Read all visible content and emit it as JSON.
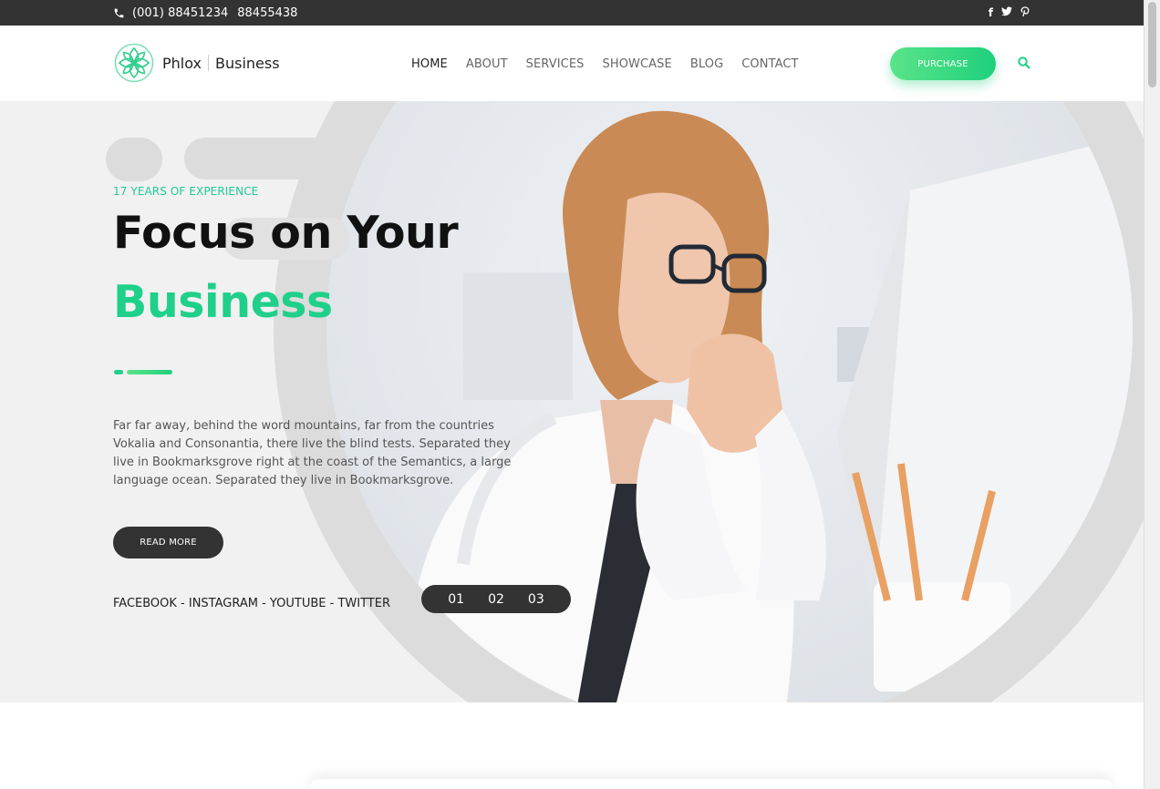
{
  "topbar": {
    "phone_primary": "(001) 88451234",
    "phone_secondary": "88455438",
    "social_icons": [
      "facebook-icon",
      "twitter-icon",
      "pinterest-icon"
    ]
  },
  "header": {
    "logo_name": "Phlox",
    "logo_suffix": "Business",
    "nav": [
      "HOME",
      "ABOUT",
      "SERVICES",
      "SHOWCASE",
      "BLOG",
      "CONTACT"
    ],
    "purchase_label": "PURCHASE"
  },
  "hero": {
    "kicker": "17 YEARS OF EXPERIENCE",
    "title_line1": "Focus on Your",
    "title_line2": "Business",
    "paragraph": "Far far away, behind the word mountains, far from the countries Vokalia and Consonantia, there live the blind tests. Separated they live in Bookmarksgrove right at the coast of the Semantics, a large language ocean. Separated they live in Bookmarksgrove.",
    "button_label": "READ MORE",
    "social_links": "FACEBOOK - INSTAGRAM - YOUTUBE - TWITTER",
    "pager": [
      "01",
      "02",
      "03"
    ]
  },
  "colors": {
    "accent": "#1fd08a",
    "dark": "#333333",
    "hero_bg": "#f1f1f1"
  }
}
